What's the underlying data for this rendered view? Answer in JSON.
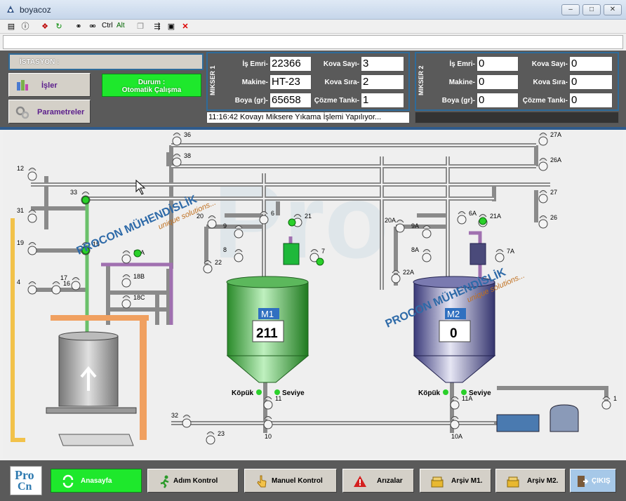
{
  "window": {
    "title": "boyacoz",
    "min": "–",
    "max": "□",
    "close": "✕"
  },
  "toolbar": {
    "ctrl": "Ctrl",
    "alt": "Alt"
  },
  "header": {
    "station_label": "İSTASYON  :",
    "jobs_button": "İşler",
    "params_button": "Parametreler",
    "status_line1": "Durum :",
    "status_line2": "Otomatik Çalışma",
    "message": "11:16:42 Kovayı Miksere Yıkama İşlemi Yapılıyor..."
  },
  "mixer1": {
    "title": "MIKSER 1",
    "labels": {
      "order": "İş Emri-",
      "machine": "Makine-",
      "paint": "Boya (gr)-",
      "bucket_count": "Kova Sayı-",
      "bucket_order": "Kova Sıra-",
      "dissolve": "Çözme Tankı-"
    },
    "values": {
      "order": "22366",
      "machine": "HT-23",
      "paint": "65658",
      "bucket_count": "3",
      "bucket_order": "2",
      "dissolve": "1"
    }
  },
  "mixer2": {
    "title": "MIKSER 2",
    "labels": {
      "order": "İş Emri-",
      "machine": "Makine-",
      "paint": "Boya (gr)-",
      "bucket_count": "Kova Sayı-",
      "bucket_order": "Kova Sıra-",
      "dissolve": "Çözme Tankı-"
    },
    "values": {
      "order": "0",
      "machine": "0",
      "paint": "0",
      "bucket_count": "0",
      "bucket_order": "0",
      "dissolve": "0"
    }
  },
  "process": {
    "tank1": {
      "name": "M1",
      "value": "211"
    },
    "tank2": {
      "name": "M2",
      "value": "0"
    },
    "foam_label": "Köpük",
    "level_label": "Seviye",
    "watermark_brand": "PROCON MÜHENDİSLİK",
    "watermark_slogan": "unique solutions...",
    "valve_labels": [
      "12",
      "31",
      "19",
      "4",
      "33",
      "15",
      "17",
      "16",
      "18A",
      "18B",
      "18C",
      "36",
      "38",
      "20",
      "22",
      "9",
      "8",
      "6",
      "21",
      "7",
      "11",
      "10",
      "23",
      "32",
      "20A",
      "22A",
      "9A",
      "8A",
      "6A",
      "21A",
      "7A",
      "11A",
      "10A",
      "27A",
      "26A",
      "27",
      "26",
      "1"
    ]
  },
  "footer": {
    "logo_top": "Pro",
    "logo_bottom": "Cn",
    "home": "Anasayfa",
    "step": "Adım  Kontrol",
    "manual": "Manuel Kontrol",
    "faults": "Arızalar",
    "archive1": "Arşiv M1.",
    "archive2": "Arşiv M2.",
    "exit": "ÇIKIŞ"
  }
}
